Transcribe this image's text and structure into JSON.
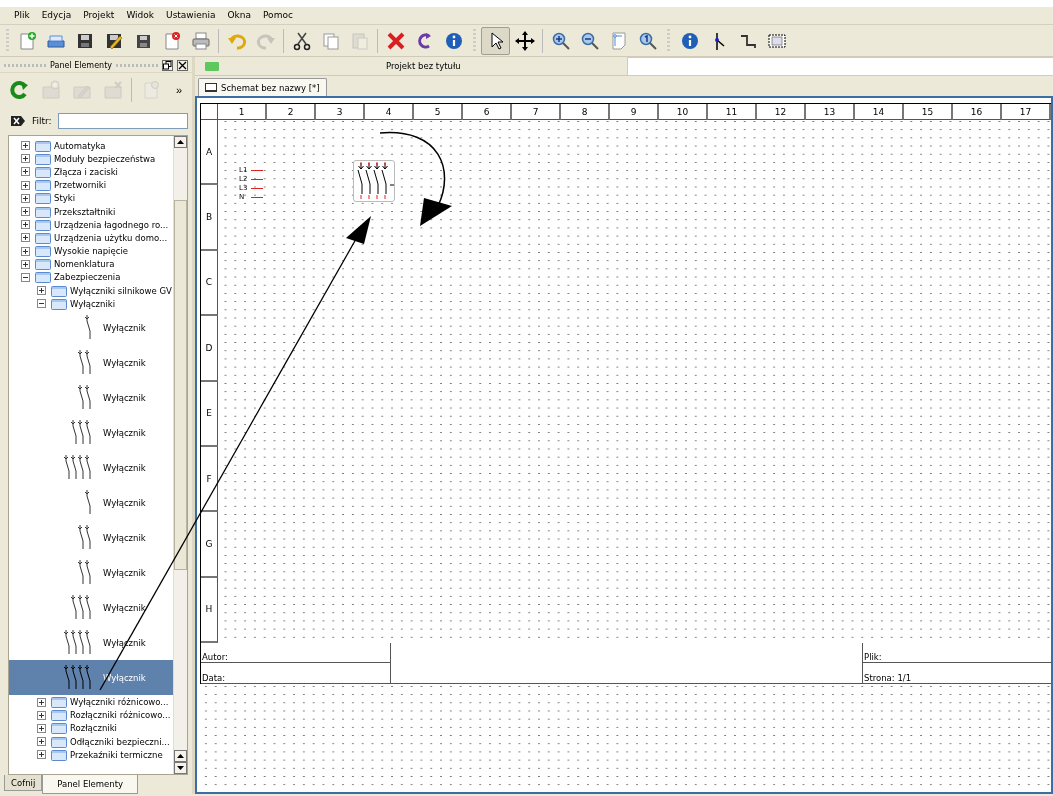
{
  "menu": [
    "Plik",
    "Edycja",
    "Projekt",
    "Widok",
    "Ustawienia",
    "Okna",
    "Pomoc"
  ],
  "toolbar": [
    {
      "kind": "new",
      "disabled": false
    },
    {
      "kind": "open",
      "disabled": false
    },
    {
      "kind": "save",
      "disabled": false
    },
    {
      "kind": "save-as",
      "disabled": false
    },
    {
      "kind": "save-all",
      "disabled": false
    },
    {
      "kind": "close",
      "disabled": false
    },
    {
      "kind": "print",
      "disabled": false
    },
    {
      "kind": "separator"
    },
    {
      "kind": "undo",
      "disabled": false
    },
    {
      "kind": "redo",
      "disabled": true
    },
    {
      "kind": "separator"
    },
    {
      "kind": "cut",
      "disabled": false
    },
    {
      "kind": "copy",
      "disabled": false
    },
    {
      "kind": "paste",
      "disabled": true
    },
    {
      "kind": "separator"
    },
    {
      "kind": "delete",
      "disabled": false
    },
    {
      "kind": "rotate",
      "disabled": false
    },
    {
      "kind": "info",
      "disabled": false
    },
    {
      "kind": "grip"
    },
    {
      "kind": "select",
      "disabled": false,
      "selected": true
    },
    {
      "kind": "move",
      "disabled": false,
      "selected": false
    },
    {
      "kind": "separator"
    },
    {
      "kind": "zoom-in",
      "disabled": false
    },
    {
      "kind": "zoom-out",
      "disabled": false
    },
    {
      "kind": "zoom-fit",
      "disabled": false
    },
    {
      "kind": "zoom-reset",
      "disabled": false
    },
    {
      "kind": "grip"
    },
    {
      "kind": "info",
      "disabled": false
    },
    {
      "kind": "conductor",
      "disabled": false
    },
    {
      "kind": "wire",
      "disabled": false
    },
    {
      "kind": "text",
      "disabled": false
    }
  ],
  "panel": {
    "title": "Panel Elementy",
    "toolbar": [
      {
        "kind": "reload",
        "disabled": false
      },
      {
        "kind": "add-folder",
        "disabled": true
      },
      {
        "kind": "edit-folder",
        "disabled": true
      },
      {
        "kind": "delete-folder",
        "disabled": true
      },
      {
        "kind": "separator"
      },
      {
        "kind": "new-element",
        "disabled": true
      }
    ],
    "overflow": "»",
    "filter": {
      "label": "Filtr:"
    },
    "tree": [
      {
        "kind": "folder",
        "label": "Automatyka",
        "expanded": false,
        "selected": false
      },
      {
        "kind": "folder",
        "label": "Moduły bezpieczeństwa",
        "expanded": false,
        "selected": false
      },
      {
        "kind": "folder",
        "label": "Złącza i zaciski",
        "expanded": false,
        "selected": false
      },
      {
        "kind": "folder",
        "label": "Przetworniki",
        "expanded": false,
        "selected": false
      },
      {
        "kind": "folder",
        "label": "Styki",
        "expanded": false,
        "selected": false
      },
      {
        "kind": "folder",
        "label": "Przekształtniki",
        "expanded": false,
        "selected": false
      },
      {
        "kind": "folder",
        "label": "Urządzenia łagodnego ro...",
        "expanded": false,
        "selected": false
      },
      {
        "kind": "folder",
        "label": "Urządzenia użytku domo...",
        "expanded": false,
        "selected": false
      },
      {
        "kind": "folder",
        "label": "Wysokie napięcie",
        "expanded": false,
        "selected": false
      },
      {
        "kind": "folder",
        "label": "Nomenklatura",
        "expanded": false,
        "selected": false
      },
      {
        "kind": "folder",
        "label": "Zabezpieczenia",
        "expanded": true,
        "selected": false,
        "children": [
          {
            "kind": "folder",
            "label": "Wyłączniki silnikowe GV",
            "expanded": false,
            "selected": false
          },
          {
            "kind": "folder",
            "label": "Wyłączniki",
            "expanded": true,
            "selected": false,
            "children": [
              {
                "kind": "element",
                "label": "Wyłącznik",
                "selected": false
              },
              {
                "kind": "element",
                "label": "Wyłącznik",
                "selected": false
              },
              {
                "kind": "element",
                "label": "Wyłącznik",
                "selected": false
              },
              {
                "kind": "element",
                "label": "Wyłącznik",
                "selected": false
              },
              {
                "kind": "element",
                "label": "Wyłącznik",
                "selected": false
              },
              {
                "kind": "element",
                "label": "Wyłącznik",
                "selected": false
              },
              {
                "kind": "element",
                "label": "Wyłącznik",
                "selected": false
              },
              {
                "kind": "element",
                "label": "Wyłącznik",
                "selected": false
              },
              {
                "kind": "element",
                "label": "Wyłącznik",
                "selected": false
              },
              {
                "kind": "element",
                "label": "Wyłącznik",
                "selected": false
              },
              {
                "kind": "element",
                "label": "Wyłącznik",
                "selected": true
              }
            ]
          },
          {
            "kind": "folder",
            "label": "Wyłączniki różnicowo...",
            "expanded": false,
            "selected": false
          },
          {
            "kind": "folder",
            "label": "Rozłączniki różnicowo...",
            "expanded": false,
            "selected": false
          },
          {
            "kind": "folder",
            "label": "Rozłączniki",
            "expanded": false,
            "selected": false
          },
          {
            "kind": "folder",
            "label": "Odłączniki bezpieczni...",
            "expanded": false,
            "selected": false
          },
          {
            "kind": "folder",
            "label": "Przekaźniki termiczne",
            "expanded": false,
            "selected": false
          }
        ]
      }
    ],
    "tabs": [
      {
        "label": "Cofnij",
        "selected": false
      },
      {
        "label": "Panel Elementy",
        "selected": true
      }
    ]
  },
  "project": {
    "title": "Projekt bez tytułu",
    "tabs": [
      {
        "label": "Schemat bez nazwy [*]",
        "selected": true
      }
    ],
    "schema": {
      "columns": [
        "1",
        "2",
        "3",
        "4",
        "5",
        "6",
        "7",
        "8",
        "9",
        "10",
        "11",
        "12",
        "13",
        "14",
        "15",
        "16",
        "17"
      ],
      "rows": [
        "A",
        "B",
        "C",
        "D",
        "E",
        "F",
        "G",
        "H"
      ],
      "terminals": [
        "L1",
        "L2",
        "L3",
        "N"
      ],
      "title_block": {
        "author": "Autor:",
        "date": "Data:",
        "file": "Plik:",
        "page": "Strona: 1/1"
      }
    }
  }
}
